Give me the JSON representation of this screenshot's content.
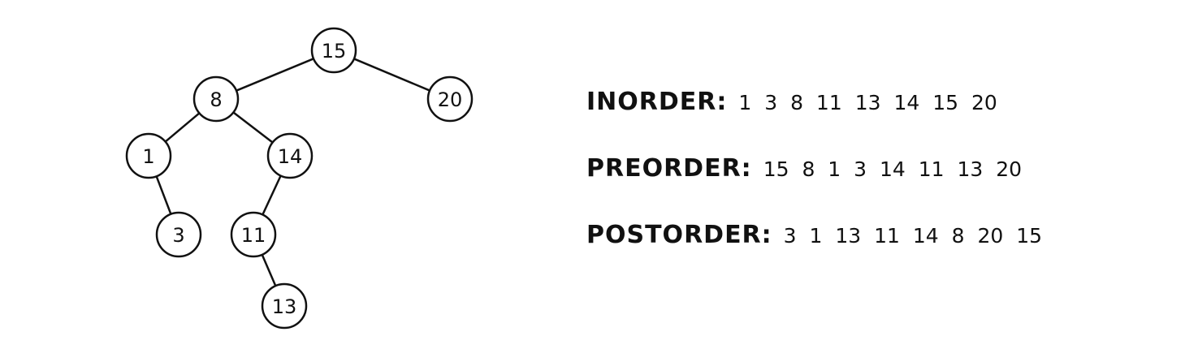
{
  "tree": {
    "nodes": [
      {
        "id": "15",
        "label": "15"
      },
      {
        "id": "8",
        "label": "8"
      },
      {
        "id": "20",
        "label": "20"
      },
      {
        "id": "1",
        "label": "1"
      },
      {
        "id": "14",
        "label": "14"
      },
      {
        "id": "3",
        "label": "3"
      },
      {
        "id": "11",
        "label": "11"
      },
      {
        "id": "13",
        "label": "13"
      }
    ],
    "edges": [
      [
        "15",
        "8"
      ],
      [
        "15",
        "20"
      ],
      [
        "8",
        "1"
      ],
      [
        "8",
        "14"
      ],
      [
        "1",
        "3"
      ],
      [
        "14",
        "11"
      ],
      [
        "11",
        "13"
      ]
    ]
  },
  "traversals": [
    {
      "label": "INORDER:",
      "values": "1 3 8 11 13 14 15 20"
    },
    {
      "label": "PREORDER:",
      "values": "15 8 1 3 14 11 13 20"
    },
    {
      "label": "POSTORDER:",
      "values": "3 1 13 11 14 8 20 15"
    }
  ]
}
